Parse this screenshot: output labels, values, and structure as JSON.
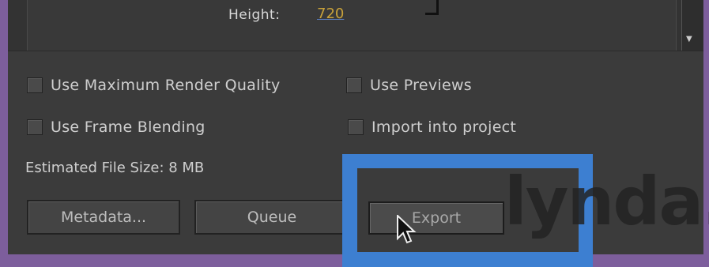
{
  "top": {
    "height_label": "Height:",
    "height_value": "720"
  },
  "options": {
    "max_render_quality": "Use Maximum Render Quality",
    "use_previews": "Use Previews",
    "frame_blending": "Use Frame Blending",
    "import_into_project": "Import into project"
  },
  "estimated_file_size": "Estimated File Size:  8 MB",
  "buttons": {
    "metadata": "Metadata...",
    "queue": "Queue",
    "export": "Export"
  },
  "watermark": "lynda.",
  "colors": {
    "highlight": "#3d7fd1",
    "background": "#7d5e9c",
    "panel": "#3b3b3b"
  }
}
